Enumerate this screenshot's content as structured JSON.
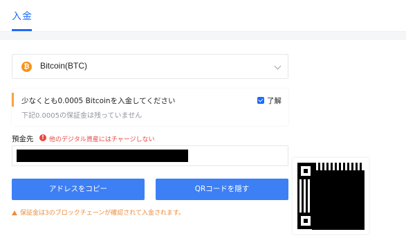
{
  "tabs": {
    "active_label": "入金"
  },
  "currency_select": {
    "icon": "bitcoin-icon",
    "value": "Bitcoin(BTC)"
  },
  "notice": {
    "main_text": "少なくとも0.0005 Bitcoinを入金してください",
    "sub_text": "下記0.0005の保証金は残っていません",
    "checkbox_label": "了解",
    "checkbox_checked": true
  },
  "address": {
    "label": "預金先",
    "warning_text": "他のデジタル資産にはチャージしない",
    "value_redacted": true
  },
  "buttons": {
    "copy_label": "アドレスをコピー",
    "hide_qr_label": "QRコードを隠す"
  },
  "footnote": "保証金は3のブロックチェーンが確認されて入金されます。",
  "colors": {
    "accent": "#1f6bf4",
    "button": "#3d7ff5",
    "warning": "#e8473f",
    "notice_bar": "#f7a442",
    "footnote": "#ee8b3a",
    "bitcoin": "#f7931a"
  }
}
